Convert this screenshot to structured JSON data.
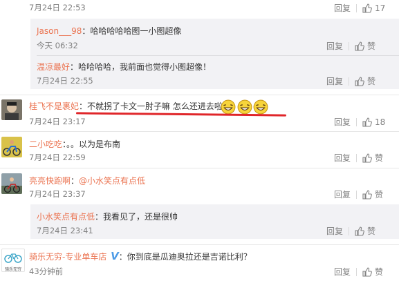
{
  "comments": [
    {
      "time": "7月24日 22:53",
      "reply": "回复",
      "likes": "17"
    },
    {
      "user": "Jason___98",
      "sep": "：",
      "text": "哈哈哈哈哈图一小图超像",
      "time": "今天 06:32",
      "reply": "回复",
      "like": "赞"
    },
    {
      "user": "温凉最好",
      "sep": "：",
      "text": "哈哈哈哈，我前面也觉得小图超像！",
      "time": "7月24日 22:55",
      "reply": "回复",
      "like": "赞"
    },
    {
      "user": "桂飞不是裹妃",
      "sep": "：",
      "text": "不就拐了卡文一肘子嘛 怎么还进去啦",
      "time": "7月24日 23:17",
      "reply": "回复",
      "likes": "18"
    },
    {
      "user": "二小吃吃",
      "sep": "：",
      "text": "。。以为是布南",
      "time": "7月24日 22:59",
      "reply": "回复",
      "like": "赞"
    },
    {
      "user": "亮亮快跑啊",
      "sep": "：",
      "mention": "@小水笑点有点低",
      "time": "7月24日 23:37",
      "reply": "回复",
      "like": "赞"
    },
    {
      "user": "小水笑点有点低",
      "sep": "：",
      "text": "我看见了，还是很帅",
      "time": "7月24日 23:41",
      "reply": "回复",
      "like": "赞"
    },
    {
      "user": "骑乐无穷-专业单车店",
      "verified": "V",
      "sep": "：",
      "text": "你到底是瓜迪奥拉还是吉诺比利？",
      "time": "43分钟前",
      "reply": "回复",
      "like": "赞"
    }
  ],
  "avatar_logo_text": "骑乐无穷",
  "colors": {
    "username": "#eb7350",
    "annotation": "#e0262a",
    "verified": "#4d9be6"
  }
}
